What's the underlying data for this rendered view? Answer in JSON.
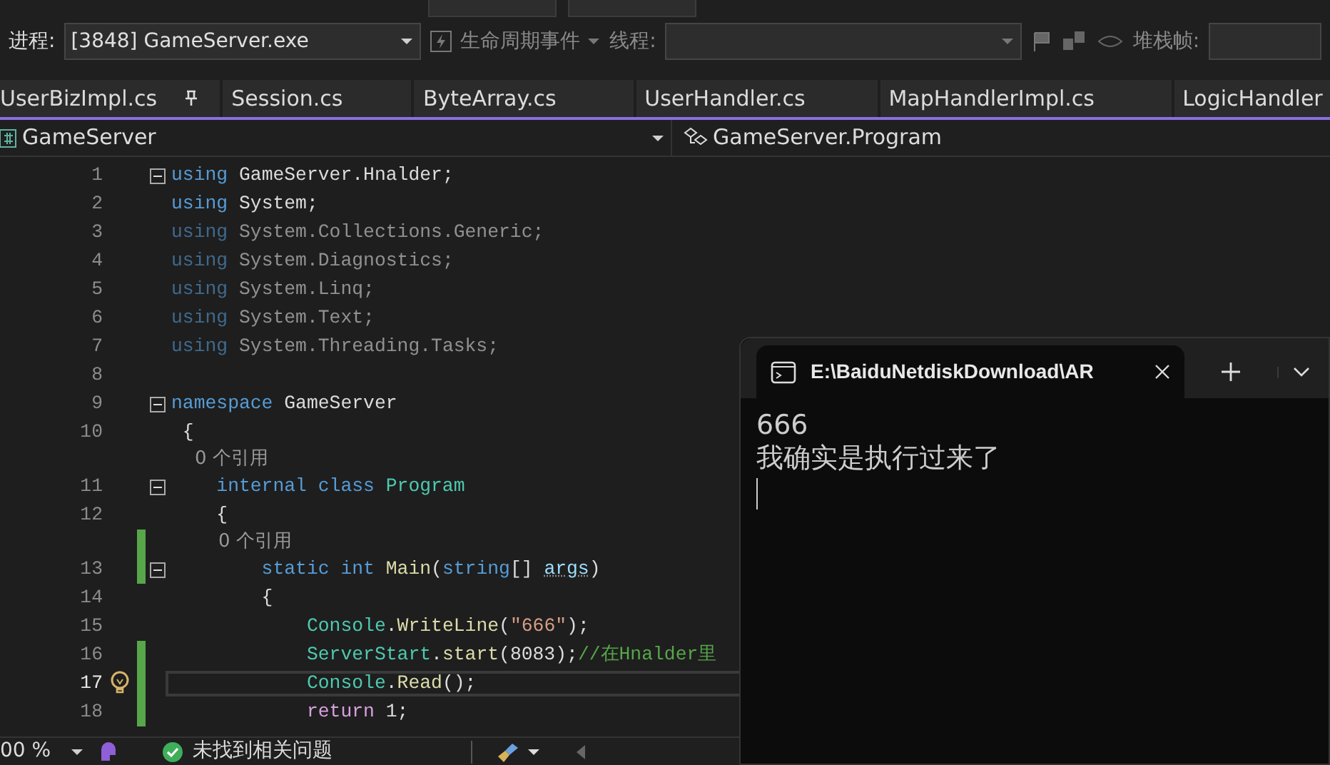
{
  "debug_toolbar": {
    "process_label": "进程:",
    "process_value": "[3848] GameServer.exe",
    "lifecycle_label": "生命周期事件",
    "thread_label": "线程:",
    "stack_label": "堆栈帧:"
  },
  "tabs": [
    {
      "label": "UserBizImpl.cs",
      "pinned": true
    },
    {
      "label": "Session.cs",
      "pinned": false
    },
    {
      "label": "ByteArray.cs",
      "pinned": false
    },
    {
      "label": "UserHandler.cs",
      "pinned": false
    },
    {
      "label": "MapHandlerImpl.cs",
      "pinned": false
    },
    {
      "label": "LogicHandler",
      "pinned": false
    }
  ],
  "navigation": {
    "project": "GameServer",
    "type": "GameServer.Program"
  },
  "code": {
    "lines": [
      {
        "kind": "code",
        "number": "1",
        "fold": true,
        "changed": false,
        "dimmed": false,
        "current": false,
        "tokens": [
          {
            "kind": "keyword",
            "text": "using"
          },
          {
            "kind": "plain",
            "text": " GameServer.Hnalder;"
          }
        ]
      },
      {
        "kind": "code",
        "number": "2",
        "fold": false,
        "changed": false,
        "dimmed": false,
        "current": false,
        "tokens": [
          {
            "kind": "keyword",
            "text": "using"
          },
          {
            "kind": "plain",
            "text": " System;"
          }
        ]
      },
      {
        "kind": "code",
        "number": "3",
        "fold": false,
        "changed": false,
        "dimmed": true,
        "current": false,
        "tokens": [
          {
            "kind": "keyword",
            "text": "using"
          },
          {
            "kind": "plain",
            "text": " System.Collections.Generic;"
          }
        ]
      },
      {
        "kind": "code",
        "number": "4",
        "fold": false,
        "changed": false,
        "dimmed": true,
        "current": false,
        "tokens": [
          {
            "kind": "keyword",
            "text": "using"
          },
          {
            "kind": "plain",
            "text": " System.Diagnostics;"
          }
        ]
      },
      {
        "kind": "code",
        "number": "5",
        "fold": false,
        "changed": false,
        "dimmed": true,
        "current": false,
        "tokens": [
          {
            "kind": "keyword",
            "text": "using"
          },
          {
            "kind": "plain",
            "text": " System.Linq;"
          }
        ]
      },
      {
        "kind": "code",
        "number": "6",
        "fold": false,
        "changed": false,
        "dimmed": true,
        "current": false,
        "tokens": [
          {
            "kind": "keyword",
            "text": "using"
          },
          {
            "kind": "plain",
            "text": " System.Text;"
          }
        ]
      },
      {
        "kind": "code",
        "number": "7",
        "fold": false,
        "changed": false,
        "dimmed": true,
        "current": false,
        "tokens": [
          {
            "kind": "keyword",
            "text": "using"
          },
          {
            "kind": "plain",
            "text": " System.Threading.Tasks;"
          }
        ]
      },
      {
        "kind": "code",
        "number": "8",
        "fold": false,
        "changed": false,
        "dimmed": false,
        "current": false
      },
      {
        "kind": "code",
        "number": "9",
        "fold": true,
        "changed": false,
        "dimmed": false,
        "current": false,
        "tokens": [
          {
            "kind": "keyword",
            "text": "namespace"
          },
          {
            "kind": "plain",
            "text": " GameServer"
          }
        ]
      },
      {
        "kind": "code",
        "number": "10",
        "fold": false,
        "changed": false,
        "dimmed": false,
        "current": false,
        "tokens": [
          {
            "kind": "plain",
            "text": " {"
          }
        ]
      },
      {
        "kind": "codelens",
        "text": "    0 个引用",
        "changed": false
      },
      {
        "kind": "code",
        "number": "11",
        "fold": true,
        "changed": false,
        "dimmed": false,
        "current": false,
        "tokens": [
          {
            "kind": "keyword",
            "text": "    internal"
          },
          {
            "kind": "keyword",
            "text": " class"
          },
          {
            "kind": "type",
            "text": " Program"
          }
        ]
      },
      {
        "kind": "code",
        "number": "12",
        "fold": false,
        "changed": false,
        "dimmed": false,
        "current": false,
        "tokens": [
          {
            "kind": "plain",
            "text": "    {"
          }
        ]
      },
      {
        "kind": "codelens",
        "text": "        0 个引用",
        "changed": true
      },
      {
        "kind": "code",
        "number": "13",
        "fold": true,
        "changed": true,
        "dimmed": false,
        "current": false,
        "tokens": [
          {
            "kind": "keyword",
            "text": "        static"
          },
          {
            "kind": "keyword",
            "text": " int"
          },
          {
            "kind": "method",
            "text": " Main"
          },
          {
            "kind": "plain",
            "text": "("
          },
          {
            "kind": "keyword",
            "text": "string"
          },
          {
            "kind": "plain",
            "text": "[] "
          },
          {
            "kind": "param",
            "text": "args"
          },
          {
            "kind": "plain",
            "text": ")"
          }
        ]
      },
      {
        "kind": "code",
        "number": "14",
        "fold": false,
        "changed": false,
        "dimmed": false,
        "current": false,
        "tokens": [
          {
            "kind": "plain",
            "text": "        {"
          }
        ]
      },
      {
        "kind": "code",
        "number": "15",
        "fold": false,
        "changed": false,
        "dimmed": false,
        "current": false,
        "tokens": [
          {
            "kind": "type",
            "text": "            Console"
          },
          {
            "kind": "plain",
            "text": "."
          },
          {
            "kind": "method",
            "text": "WriteLine"
          },
          {
            "kind": "plain",
            "text": "("
          },
          {
            "kind": "string",
            "text": "\"666\""
          },
          {
            "kind": "plain",
            "text": ");"
          }
        ]
      },
      {
        "kind": "code",
        "number": "16",
        "fold": false,
        "changed": true,
        "dimmed": false,
        "current": false,
        "tokens": [
          {
            "kind": "type",
            "text": "            ServerStart"
          },
          {
            "kind": "plain",
            "text": "."
          },
          {
            "kind": "method",
            "text": "start"
          },
          {
            "kind": "plain",
            "text": "(8083);"
          },
          {
            "kind": "comment",
            "text": "//在Hnalder里"
          }
        ]
      },
      {
        "kind": "code",
        "number": "17",
        "fold": false,
        "changed": true,
        "dimmed": false,
        "current": true,
        "tokens": [
          {
            "kind": "type",
            "text": "            Console"
          },
          {
            "kind": "plain",
            "text": "."
          },
          {
            "kind": "method",
            "text": "Read"
          },
          {
            "kind": "plain",
            "text": "();"
          }
        ]
      },
      {
        "kind": "code",
        "number": "18",
        "fold": false,
        "changed": true,
        "dimmed": false,
        "current": false,
        "tokens": [
          {
            "kind": "control",
            "text": "            return"
          },
          {
            "kind": "plain",
            "text": " 1;"
          }
        ]
      }
    ]
  },
  "status_bar": {
    "zoom": "00 %",
    "issues": "未找到相关问题"
  },
  "console": {
    "title": "E:\\BaiduNetdiskDownload\\AR",
    "output": [
      "666",
      "我确实是执行过来了"
    ]
  }
}
